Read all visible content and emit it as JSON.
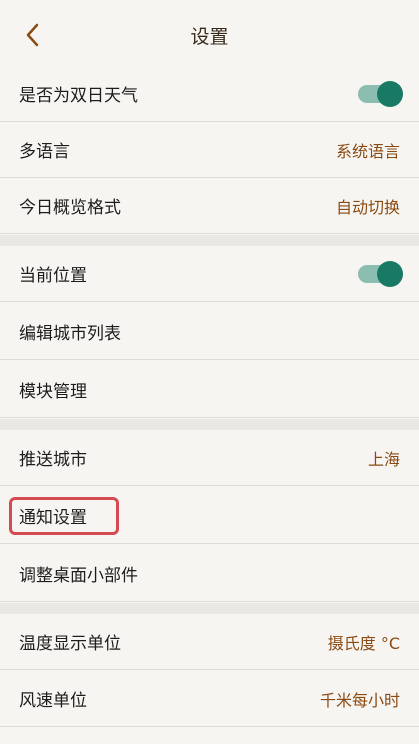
{
  "header": {
    "title": "设置"
  },
  "group1": {
    "double_day": {
      "label": "是否为双日天气",
      "toggle_on": true
    },
    "language": {
      "label": "多语言",
      "value": "系统语言"
    },
    "today_format": {
      "label": "今日概览格式",
      "value": "自动切换"
    }
  },
  "group2": {
    "current_location": {
      "label": "当前位置",
      "toggle_on": true
    },
    "edit_cities": {
      "label": "编辑城市列表"
    },
    "module_manage": {
      "label": "模块管理"
    }
  },
  "group3": {
    "push_city": {
      "label": "推送城市",
      "value": "上海"
    },
    "notify_settings": {
      "label": "通知设置"
    },
    "widget_adjust": {
      "label": "调整桌面小部件"
    }
  },
  "group4": {
    "temp_unit": {
      "label": "温度显示单位",
      "value": "摄氏度 °C"
    },
    "wind_unit": {
      "label": "风速单位",
      "value": "千米每小时"
    }
  },
  "colors": {
    "accent_text": "#8a4b13",
    "toggle_knob": "#187a64",
    "toggle_track": "#8cbdb1",
    "highlight_border": "#d64a52"
  }
}
